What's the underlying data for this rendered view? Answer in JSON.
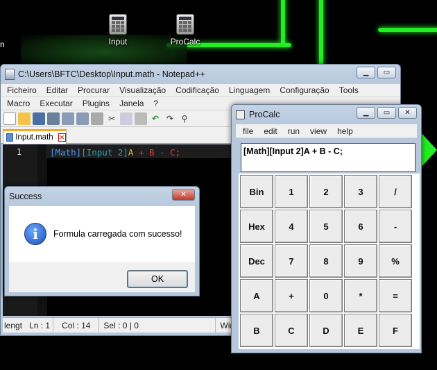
{
  "desktop": {
    "icons": [
      {
        "label": "Input"
      },
      {
        "label": "ProCalc"
      }
    ],
    "edge_label": "n"
  },
  "notepad": {
    "title": "C:\\Users\\BFTC\\Desktop\\Input.math - Notepad++",
    "menu_row1": [
      "Ficheiro",
      "Editar",
      "Procurar",
      "Visualização",
      "Codificação",
      "Linguagem",
      "Configuração",
      "Tools"
    ],
    "menu_row2": [
      "Macro",
      "Executar",
      "Plugins",
      "Janela",
      "?"
    ],
    "tab_label": "Input.math",
    "line_number": "1",
    "code": {
      "tok1": "[Math]",
      "tok2": "[Input 2]",
      "tok3": "A",
      "tok4": " + ",
      "tok5": "B",
      "tok6": " - ",
      "tok7": "C;"
    },
    "status": {
      "length": "lengt",
      "ln": "Ln : 1",
      "col": "Col : 14",
      "sel": "Sel : 0 | 0",
      "eol": "Window"
    }
  },
  "dialog": {
    "title": "Success",
    "message": "Formula carregada com sucesso!",
    "ok_label": "OK"
  },
  "procalc": {
    "title": "ProCalc",
    "menu": [
      "file",
      "edit",
      "run",
      "view",
      "help"
    ],
    "display": "[Math][Input 2]A + B - C;",
    "keys": [
      "Bin",
      "1",
      "2",
      "3",
      "/",
      "Hex",
      "4",
      "5",
      "6",
      "-",
      "Dec",
      "7",
      "8",
      "9",
      "%",
      "A",
      "+",
      "0",
      "*",
      "=",
      "B",
      "C",
      "D",
      "E",
      "F"
    ]
  }
}
